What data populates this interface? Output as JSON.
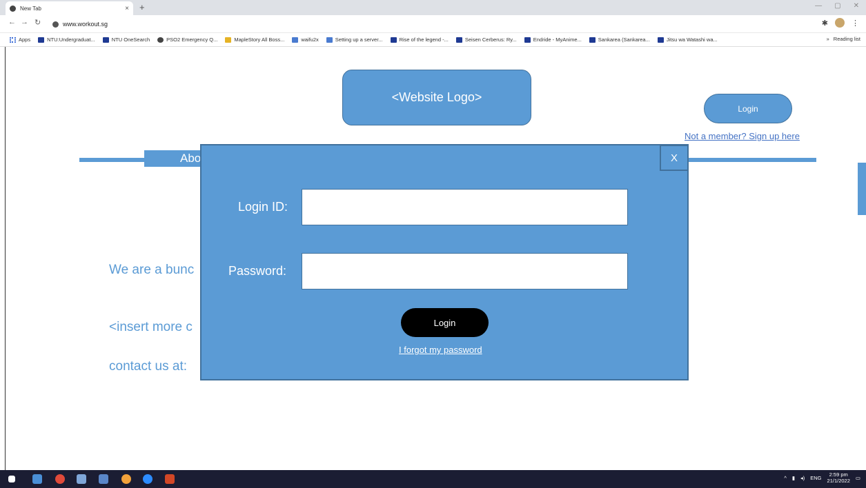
{
  "browser": {
    "tab_title": "New Tab",
    "tab_close": "×",
    "new_tab": "+",
    "url": "www.workout.sg",
    "win_min": "—",
    "win_max": "▢",
    "win_close": "✕",
    "bookmarks": [
      {
        "label": "Apps",
        "icon": "apps"
      },
      {
        "label": "NTU:Undergraduat...",
        "icon": "ntu"
      },
      {
        "label": "NTU OneSearch",
        "icon": "ntu"
      },
      {
        "label": "PSO2 Emergency Q...",
        "icon": "globe"
      },
      {
        "label": "MapleStory All Boss...",
        "icon": "maple"
      },
      {
        "label": "waifu2x",
        "icon": "w"
      },
      {
        "label": "Setting up a server...",
        "icon": "r"
      },
      {
        "label": "Rise of the legend -...",
        "icon": "g"
      },
      {
        "label": "Seisen Cerberus: Ry...",
        "icon": "mal"
      },
      {
        "label": "Endride - MyAnime...",
        "icon": "mal"
      },
      {
        "label": "Sankarea (Sankarea...",
        "icon": "mal"
      },
      {
        "label": "Jitsu wa Watashi wa...",
        "icon": "mal"
      }
    ],
    "bookmarks_more": "»",
    "reading_list": "Reading list"
  },
  "page": {
    "logo_text": "<Website Logo>",
    "login_button": "Login",
    "signup_link": "Not a member? Sign up here",
    "nav_tab_partial": "Abo",
    "body_line1": "We are a bunc",
    "body_line2": "<insert more c",
    "body_line3": "contact us at:"
  },
  "modal": {
    "close_label": "X",
    "login_id_label": "Login ID:",
    "password_label": "Password:",
    "login_id_value": "",
    "password_value": "",
    "login_button": "Login",
    "forgot_link": "I forgot my password"
  },
  "taskbar": {
    "lang": "ENG",
    "time": "2:59 pm",
    "date": "21/1/2022"
  },
  "colors": {
    "accent": "#5b9bd5",
    "accent_border": "#41719c",
    "link": "#4472c4",
    "taskbar": "#1b1d33"
  }
}
